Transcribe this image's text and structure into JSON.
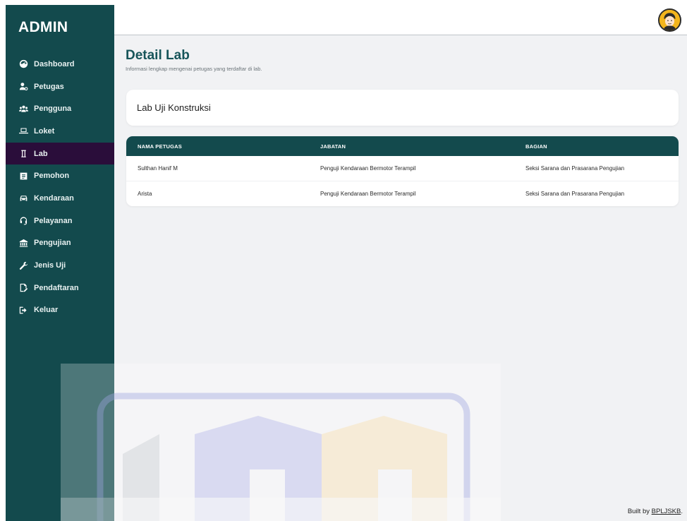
{
  "sidebar": {
    "brand": "ADMIN",
    "items": [
      {
        "label": "Dashboard",
        "icon": "dashboard-icon",
        "active": false
      },
      {
        "label": "Petugas",
        "icon": "user-tie-icon",
        "active": false
      },
      {
        "label": "Pengguna",
        "icon": "users-icon",
        "active": false
      },
      {
        "label": "Loket",
        "icon": "laptop-icon",
        "active": false
      },
      {
        "label": "Lab",
        "icon": "flask-icon",
        "active": true
      },
      {
        "label": "Pemohon",
        "icon": "id-card-icon",
        "active": false
      },
      {
        "label": "Kendaraan",
        "icon": "car-icon",
        "active": false
      },
      {
        "label": "Pelayanan",
        "icon": "headset-icon",
        "active": false
      },
      {
        "label": "Pengujian",
        "icon": "building-icon",
        "active": false
      },
      {
        "label": "Jenis Uji",
        "icon": "wrench-icon",
        "active": false
      },
      {
        "label": "Pendaftaran",
        "icon": "signature-icon",
        "active": false
      },
      {
        "label": "Keluar",
        "icon": "logout-icon",
        "active": false
      }
    ]
  },
  "header": {
    "title": "Detail Lab",
    "subtitle": "Informasi lengkap mengenai petugas yang terdaftar di lab."
  },
  "lab": {
    "name": "Lab Uji Konstruksi"
  },
  "table": {
    "columns": [
      "NAMA PETUGAS",
      "JABATAN",
      "BAGIAN"
    ],
    "rows": [
      [
        "Sulthan Hanif M",
        "Penguji Kendaraan Bermotor Terampil",
        "Seksi Sarana dan Prasarana Pengujian"
      ],
      [
        "Arista",
        "Penguji Kendaraan Bermotor Terampil",
        "Seksi Sarana dan Prasarana Pengujian"
      ]
    ]
  },
  "footer": {
    "prefix": "Built by ",
    "link": "BPLJSKB",
    "suffix": "."
  },
  "colors": {
    "sidebar": "#134a4d",
    "sidebar_active": "#2a0d3a",
    "accent": "#17555a",
    "background": "#f1f2f4",
    "avatar": "#f3b51c"
  }
}
